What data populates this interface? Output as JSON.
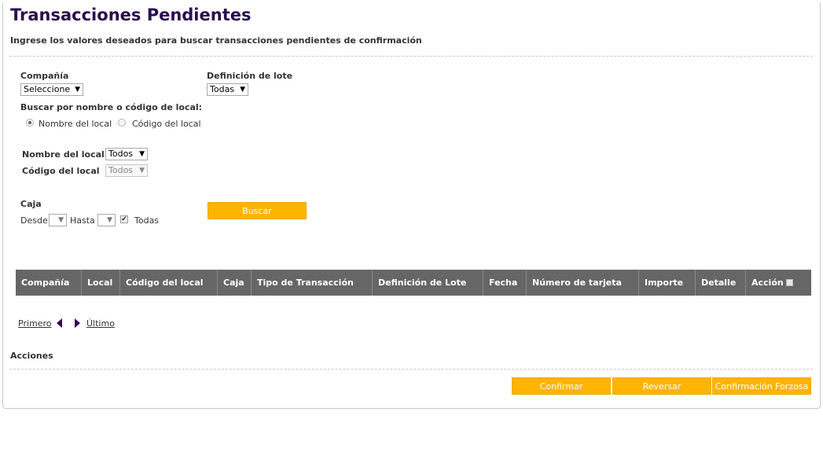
{
  "header": {
    "title": "Transacciones Pendientes",
    "subtitle": "Ingrese los valores deseados para buscar transacciones pendientes de confirmación"
  },
  "filters": {
    "company_label": "Compañía",
    "company_value": "Seleccione",
    "batch_label": "Definición de lote",
    "batch_value": "Todas",
    "search_by_label": "Buscar por nombre o código de local:",
    "radio_name_label": "Nombre del local",
    "radio_code_label": "Código del local",
    "radio_selected": "Nombre del local",
    "store_name_label": "Nombre del local",
    "store_name_value": "Todos",
    "store_code_label": "Código del local",
    "store_code_value": "Todos",
    "register_label": "Caja",
    "from_label": "Desde",
    "from_value": "",
    "to_label": "Hasta",
    "to_value": "",
    "all_label": "Todas",
    "all_checked": true,
    "search_button": "Buscar"
  },
  "table": {
    "columns": [
      "Compañía",
      "Local",
      "Código del local",
      "Caja",
      "Tipo de Transacción",
      "Definición de Lote",
      "Fecha",
      "Número de tarjeta",
      "Importe",
      "Detalle",
      "Acción"
    ]
  },
  "pager": {
    "first": "Primero",
    "last": "Último"
  },
  "actions": {
    "title": "Acciones",
    "confirm": "Confirmar",
    "reverse": "Reversar",
    "force_confirm": "Confirmación Forzosa"
  },
  "colors": {
    "title": "#2b0c4e",
    "button": "#ffb400",
    "table_header": "#666666"
  }
}
